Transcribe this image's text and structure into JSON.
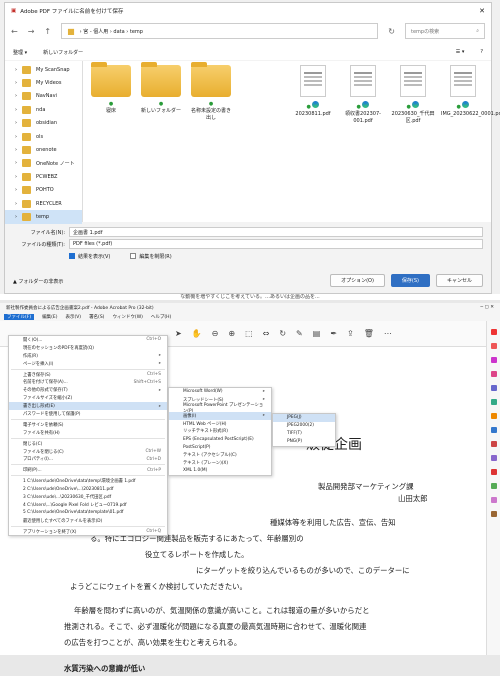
{
  "dialog": {
    "title": "Adobe PDF ファイルに名前を付けて保存",
    "nav": [
      "←",
      "→",
      "↑",
      "↻"
    ],
    "path": [
      "› 宮 - 個人用 › data › temp",
      "›"
    ],
    "search_placeholder": "tempの検索",
    "cmd": {
      "organize": "整理 ▾",
      "new_folder": "新しいフォルダー",
      "view": "☰ ▾",
      "help": "?"
    },
    "sidebar": [
      "My ScanSnap",
      "My Videos",
      "NavNavi",
      "nda",
      "obsidian",
      "ols",
      "onenote",
      "OneNote ノート",
      "PCWEBZ",
      "POHTO",
      "RECYCLER",
      "temp"
    ],
    "files": [
      {
        "name": "寝床",
        "kind": "folder"
      },
      {
        "name": "新しいフォルダー",
        "kind": "folder"
      },
      {
        "name": "名称未設定の書き出し",
        "kind": "folder"
      },
      {
        "name": "20230811.pdf",
        "kind": "pdf"
      },
      {
        "name": "領収書202307-001.pdf",
        "kind": "pdf"
      },
      {
        "name": "20230630_千代田区.pdf",
        "kind": "pdf"
      },
      {
        "name": "IMG_20230622_0001.pdf",
        "kind": "pdf"
      }
    ],
    "filename_label": "ファイル名(N):",
    "filename": "企画書 1.pdf",
    "type_label": "ファイルの種類(T):",
    "filetype": "PDF files (*.pdf)",
    "opt1": "結果を表示(V)",
    "opt2": "編集を制限(R)",
    "hide_folders": "▲ フォルダーの非表示",
    "buttons": {
      "options": "オプション(O)",
      "save": "保存(S)",
      "cancel": "キャンセル"
    },
    "under_text": "な動機を増やすくじこを考えている。…あるいは企画の品を..."
  },
  "acrobat": {
    "title": "新社製作委員会による広告企画書案2.pdf - Adobe Acrobat Pro (32-bit)",
    "menus": [
      "ファイル(F)",
      "編集(E)",
      "表示(V)",
      "署名(S)",
      "ウィンドウ(W)",
      "ヘルプ(H)"
    ],
    "file_menu": [
      {
        "l": "開く(O)...",
        "s": "Ctrl+O"
      },
      {
        "l": "現在のセッションのPDFを再度読(Q)",
        "s": ""
      },
      {
        "l": "作成(R)",
        "s": "▸"
      },
      {
        "l": "ページを挿入(I)",
        "s": "▸"
      },
      {
        "sep": true
      },
      {
        "l": "上書き保存(S)",
        "s": "Ctrl+S"
      },
      {
        "l": "名前を付けて保存(A)...",
        "s": "Shift+Ctrl+S"
      },
      {
        "l": "その他の形式で保存(T)",
        "s": "▸"
      },
      {
        "l": "ファイルサイズを縮小(Z)",
        "s": ""
      },
      {
        "l": "書き出し形式(E)",
        "s": "▸",
        "hl": true
      },
      {
        "l": "パスワードを使用して保護(P)",
        "s": ""
      },
      {
        "sep": true
      },
      {
        "l": "電子サインを依頼(S)",
        "s": ""
      },
      {
        "l": "ファイルを共有(H)",
        "s": ""
      },
      {
        "sep": true
      },
      {
        "l": "閉じる(C)",
        "s": ""
      },
      {
        "l": "ファイルを閉じる(C)",
        "s": "Ctrl+W"
      },
      {
        "l": "プロパティ(I)...",
        "s": "Ctrl+D"
      },
      {
        "sep": true
      },
      {
        "l": "印刷(P)...",
        "s": "Ctrl+P"
      },
      {
        "sep": true
      },
      {
        "l": "1 C:\\Users\\ude\\OneDrive\\data\\temp\\環境企画書 1.pdf",
        "s": ""
      },
      {
        "l": "2 C:\\Users\\ude\\OneDrive\\...\\20230811.pdf",
        "s": ""
      },
      {
        "l": "3 C:\\Users\\ude\\...\\20230630_千代田区.pdf",
        "s": ""
      },
      {
        "l": "4 C:\\Users\\...\\Google Pixel Fold レビュー0719.pdf",
        "s": ""
      },
      {
        "l": "5 C:\\Users\\ude\\OneDrive\\data\\template\\01.pdf",
        "s": ""
      },
      {
        "l": "最近使用したすべてのファイルを表示(D)",
        "s": ""
      },
      {
        "sep": true
      },
      {
        "l": "アプリケーションを終了(X)",
        "s": "Ctrl+Q"
      }
    ],
    "export_menu": [
      {
        "l": "Microsoft Word(W)",
        "s": "▸"
      },
      {
        "l": "スプレッドシート(S)",
        "s": "▸"
      },
      {
        "l": "Microsoft PowerPoint プレゼンテーション(P)",
        "s": ""
      },
      {
        "l": "画像(I)",
        "s": "▸",
        "hl": true
      },
      {
        "l": "HTML Web ページ(H)",
        "s": ""
      },
      {
        "l": "リッチテキスト形式(R)",
        "s": ""
      },
      {
        "l": "EPS (Encapsulated PostScript)(E)",
        "s": ""
      },
      {
        "l": "PostScript(P)",
        "s": ""
      },
      {
        "l": "テキスト (アクセシブル)(C)",
        "s": ""
      },
      {
        "l": "テキスト (プレーン)(X)",
        "s": ""
      },
      {
        "l": "XML 1.0(M)",
        "s": ""
      }
    ],
    "image_menu": [
      "JPEG(J)",
      "JPEG2000(2)",
      "TIFF(T)",
      "PNG(P)"
    ],
    "doc": {
      "title": "販促企画",
      "dept": "製品開発部マーケティング課",
      "name": "山田太郎",
      "lines": [
        "種媒体等を利用した広告、宣伝、告知",
        "る。特にエコロジー関連製品を販売するにあたって、年齢層別の",
        "役立てるレポートを作成した。",
        "にターゲットを絞り込んでいるものが多いので、このデーターに",
        "ようどこにウェイトを置くか検討していただきたい。",
        "年齢層を問わずに高いのが、気温関係の意識が高いこと。これは報道の量が多いからだと",
        "推測される。そこで、必ず温暖化が問題になる真夏の最高気温時期に合わせて、温暖化関連",
        "の広告を打つことが、高い効果を生むと考えられる。"
      ],
      "heading": "水質汚染への意識が低い"
    }
  }
}
